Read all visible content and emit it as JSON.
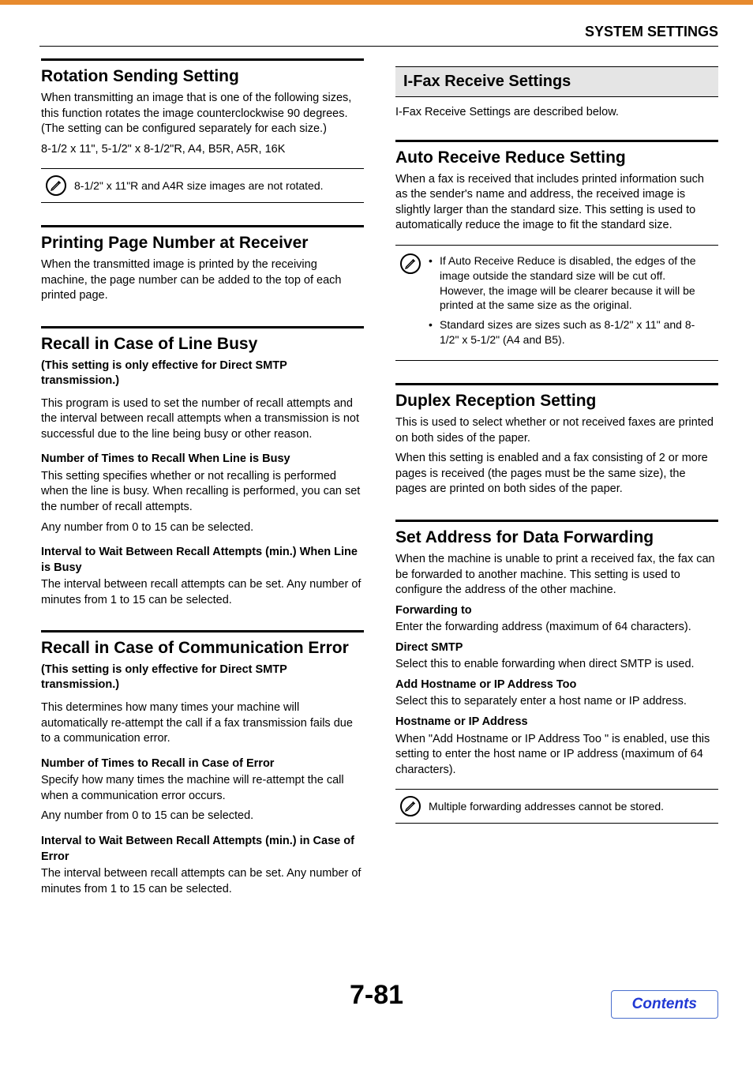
{
  "header": {
    "title": "SYSTEM SETTINGS"
  },
  "left": {
    "rotation": {
      "heading": "Rotation Sending Setting",
      "p1": "When transmitting an image that is one of the following sizes, this function rotates the image counterclockwise 90 degrees. (The setting can be configured separately for each size.)",
      "p2": "8-1/2 x 11\", 5-1/2\" x 8-1/2\"R, A4, B5R, A5R, 16K",
      "note": "8-1/2\" x 11\"R and A4R size images are not rotated."
    },
    "pagenum": {
      "heading": "Printing Page Number at Receiver",
      "p1": "When the transmitted image is printed by the receiving machine, the page number can be added to the top of each printed page."
    },
    "recall_busy": {
      "heading": "Recall in Case of Line Busy",
      "sub": "(This setting is only effective for Direct SMTP transmission.)",
      "p1": "This program is used to set the number of recall attempts and the interval between recall attempts when a transmission is not successful due to the line being busy or other reason.",
      "b1": "Number of Times to Recall When Line is Busy",
      "p2": "This setting specifies whether or not recalling is performed when the line is busy. When recalling is performed, you can set the number of recall attempts.",
      "p3": "Any number from 0 to 15 can be selected.",
      "b2": "Interval to Wait Between Recall Attempts (min.) When Line is Busy",
      "p4": "The interval between recall attempts can be set. Any number of minutes from 1 to 15 can be selected."
    },
    "recall_err": {
      "heading": "Recall in Case of Communication Error",
      "sub": "(This setting is only effective for Direct SMTP transmission.)",
      "p1": "This determines how many times your machine will automatically re-attempt the call if a fax transmission fails due to a communication error.",
      "b1": "Number of Times to Recall in Case of Error",
      "p2": "Specify how many times the machine will re-attempt the call when a communication error occurs.",
      "p3": "Any number from 0 to 15 can be selected.",
      "b2": "Interval to Wait Between Recall Attempts (min.) in Case of Error",
      "p4": "The interval between recall attempts can be set. Any number of minutes from 1 to 15 can be selected."
    }
  },
  "right": {
    "ifax_heading": "I-Fax Receive Settings",
    "ifax_desc": "I-Fax Receive Settings are described below.",
    "autoreduce": {
      "heading": "Auto Receive Reduce Setting",
      "p1": "When a fax is received that includes printed information such as the sender's name and address, the received image is slightly larger than the standard size. This setting is used to automatically reduce the image to fit the standard size.",
      "note_b1": "If Auto Receive Reduce is disabled, the edges of the image outside the standard size will be cut off. However, the image will be clearer because it will be printed at the same size as the original.",
      "note_b2": "Standard sizes are sizes such as 8-1/2\" x 11\" and 8-1/2\" x 5-1/2\" (A4 and B5)."
    },
    "duplex": {
      "heading": "Duplex Reception Setting",
      "p1": "This is used to select whether or not received faxes are printed on both sides of the paper.",
      "p2": "When this setting is enabled and a fax consisting of 2 or more pages is received (the pages must be the same size), the pages are printed on both sides of the paper."
    },
    "forward": {
      "heading": "Set Address for Data Forwarding",
      "p1": "When the machine is unable to print a received fax, the fax can be forwarded to another machine. This setting is used to configure the address of the other machine.",
      "b1": "Forwarding to",
      "p2": "Enter the forwarding address (maximum of 64 characters).",
      "b2": "Direct SMTP",
      "p3": "Select this to enable forwarding when direct SMTP is used.",
      "b3": "Add Hostname or IP Address Too",
      "p4": "Select this to separately enter a host name or IP address.",
      "b4": "Hostname or IP Address",
      "p5": "When \"Add Hostname or IP Address Too \" is enabled, use this setting to enter the host name or IP address (maximum of 64 characters).",
      "note": "Multiple forwarding addresses cannot be stored."
    }
  },
  "footer": {
    "page_number": "7-81",
    "contents_label": "Contents"
  }
}
